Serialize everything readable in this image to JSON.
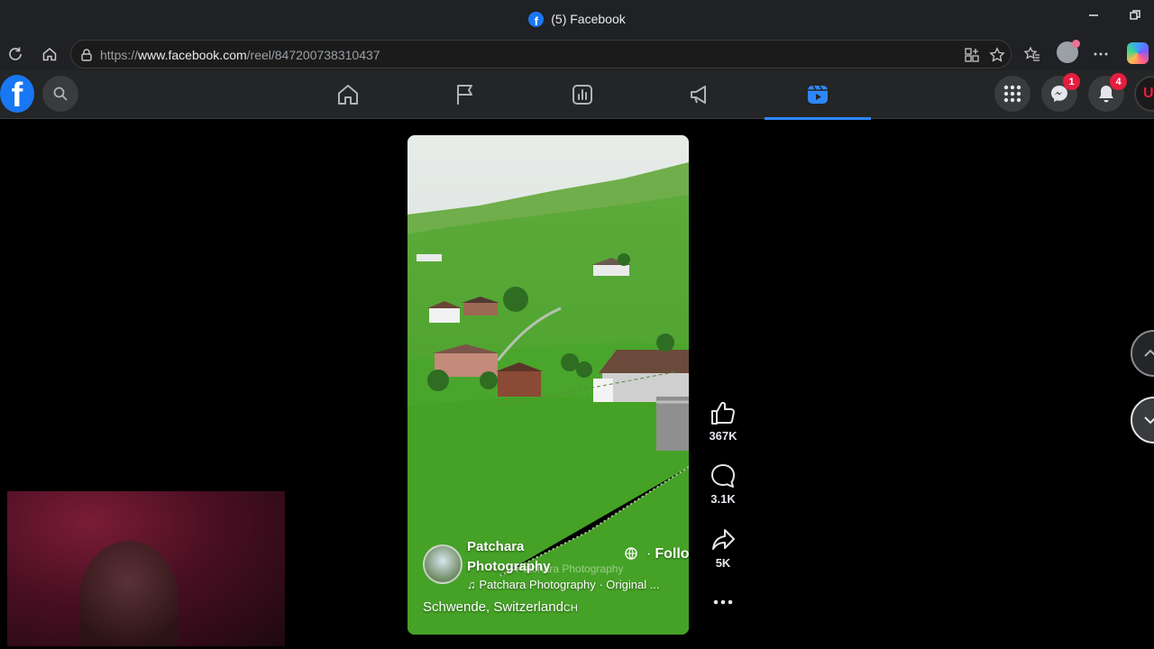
{
  "browser": {
    "tab_title": "(5) Facebook",
    "url_prefix": "https://",
    "url_domain": "www.facebook.com",
    "url_path": "/reel/847200738310437"
  },
  "fb_nav": {
    "tabs": [
      {
        "name": "home",
        "icon": "home-icon"
      },
      {
        "name": "pages",
        "icon": "flag-icon"
      },
      {
        "name": "ads-manager",
        "icon": "chart-icon"
      },
      {
        "name": "marketplace",
        "icon": "megaphone-icon"
      },
      {
        "name": "reels",
        "icon": "video-icon",
        "active": true
      }
    ],
    "messenger_badge": "1",
    "notifications_badge": "4",
    "account_initial": "U"
  },
  "reel": {
    "author": "Patchara Photography",
    "follow_label": "Follow",
    "watermark": "Patchara Photography",
    "audio": "Patchara Photography · Original ...",
    "location": "Schwende, Switzerland",
    "location_flag": "CH",
    "likes": "367K",
    "comments": "3.1K",
    "shares": "5K"
  },
  "colors": {
    "fb_blue": "#1877f2",
    "active_tab": "#2d88ff",
    "badge_red": "#e41e3f",
    "header_bg": "#242526"
  }
}
